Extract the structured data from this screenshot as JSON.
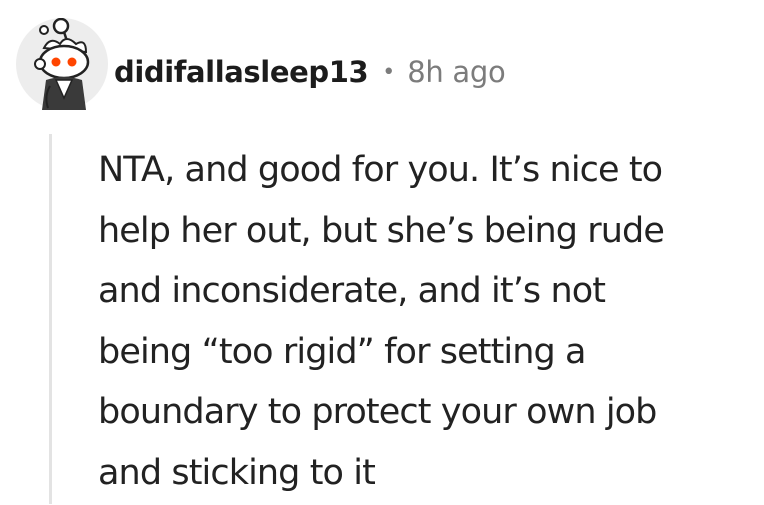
{
  "comment": {
    "author": "didifallasleep13",
    "separator": "•",
    "timestamp": "8h ago",
    "body_lines": [
      "NTA, and good for you. It’s nice to",
      "help her out, but she’s being rude",
      "and inconsiderate, and it’s not",
      "being “too rigid” for setting a",
      "boundary to protect your own job",
      "and sticking to it"
    ],
    "avatar_icon": "snoo-avatar-icon"
  },
  "colors": {
    "avatar_bg": "#ededed",
    "meta_text": "#7c7c7c",
    "thread_line": "#e3e3e3",
    "eye_red": "#ff4500"
  }
}
